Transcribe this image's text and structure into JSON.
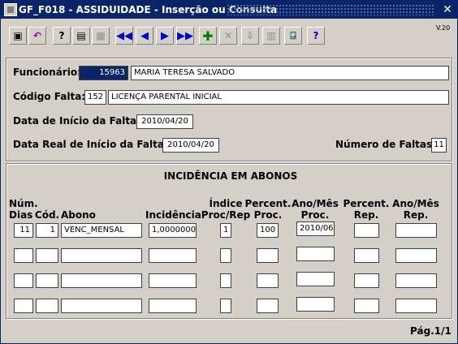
{
  "title": "GF_F018 - ASSIDUIDADE - Inserção ou Consulta",
  "close_icon": "✕",
  "version": "V.20",
  "toolbar": {
    "items": [
      {
        "name": "save-icon",
        "glyph": "▣"
      },
      {
        "name": "undo-icon",
        "glyph": "↶"
      },
      {
        "name": "query-icon",
        "glyph": "?"
      },
      {
        "name": "execute-query-icon",
        "glyph": "▤"
      },
      {
        "name": "cancel-query-icon",
        "glyph": "▦"
      },
      {
        "name": "first-record-icon",
        "glyph": "◀◀"
      },
      {
        "name": "previous-record-icon",
        "glyph": "◀"
      },
      {
        "name": "next-record-icon",
        "glyph": "▶"
      },
      {
        "name": "last-record-icon",
        "glyph": "▶▶"
      },
      {
        "name": "insert-record-icon",
        "glyph": "✚"
      },
      {
        "name": "delete-record-icon",
        "glyph": "✕"
      },
      {
        "name": "duplicate-icon",
        "glyph": "⇩"
      },
      {
        "name": "print-icon",
        "glyph": "▥"
      },
      {
        "name": "exit-icon",
        "glyph": "⍈"
      },
      {
        "name": "help-icon",
        "glyph": "?"
      }
    ]
  },
  "form": {
    "funcionario_label": "Funcionário:",
    "funcionario_num": "15963",
    "funcionario_nome": "MARIA TERESA SALVADO",
    "codigo_label": "Código Falta:",
    "codigo_num": "152",
    "codigo_desc": "LICENÇA PARENTAL INICIAL",
    "data_inicio_label": "Data de Início da Falta:",
    "data_inicio": "2010/04/20",
    "data_real_label": "Data Real de Início da Falta:",
    "data_real": "2010/04/20",
    "num_faltas_label": "Número de Faltas:",
    "num_faltas": "11"
  },
  "incidencia": {
    "title": "INCIDÊNCIA EM ABONOS",
    "headers": {
      "num_dias": "Núm.\nDias",
      "cod": "Cód.",
      "abono": "Abono",
      "incidencia": "Incidência",
      "indice": "Índice\nProc/Rep",
      "percent_proc": "Percent.\nProc.",
      "anomes_proc": "Ano/Mês\nProc.",
      "percent_rep": "Percent.\nRep.",
      "anomes_rep": "Ano/Mês\nRep."
    },
    "rows": [
      {
        "num_dias": "11",
        "cod": "1",
        "abono": "VENC_MENSAL",
        "incidencia": "1,0000000",
        "indice": "1",
        "percent_proc": "100",
        "anomes_proc": "2010/06",
        "percent_rep": "",
        "anomes_rep": ""
      },
      {
        "num_dias": "",
        "cod": "",
        "abono": "",
        "incidencia": "",
        "indice": "",
        "percent_proc": "",
        "anomes_proc": "",
        "percent_rep": "",
        "anomes_rep": ""
      },
      {
        "num_dias": "",
        "cod": "",
        "abono": "",
        "incidencia": "",
        "indice": "",
        "percent_proc": "",
        "anomes_proc": "",
        "percent_rep": "",
        "anomes_rep": ""
      },
      {
        "num_dias": "",
        "cod": "",
        "abono": "",
        "incidencia": "",
        "indice": "",
        "percent_proc": "",
        "anomes_proc": "",
        "percent_rep": "",
        "anomes_rep": ""
      }
    ]
  },
  "pagination": "Pág.1/1"
}
